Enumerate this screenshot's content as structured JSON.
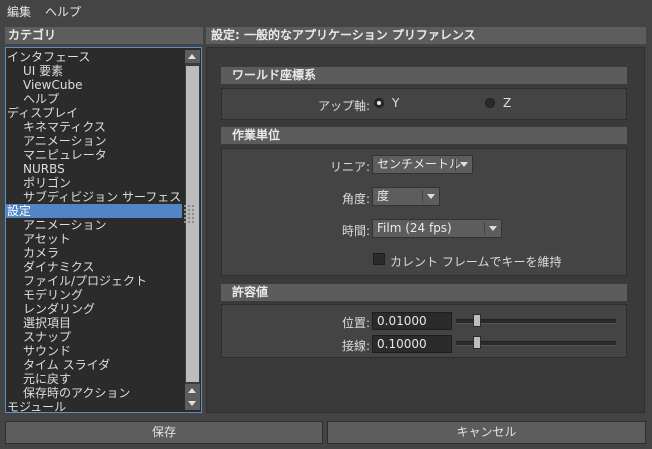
{
  "menu": {
    "edit": "編集",
    "help": "ヘルプ"
  },
  "categories": {
    "header": "カテゴリ",
    "items": [
      {
        "label": "インタフェース",
        "level": "top"
      },
      {
        "label": "UI 要素",
        "level": "sub"
      },
      {
        "label": "ViewCube",
        "level": "sub"
      },
      {
        "label": "ヘルプ",
        "level": "sub"
      },
      {
        "label": "ディスプレイ",
        "level": "top"
      },
      {
        "label": "キネマティクス",
        "level": "sub"
      },
      {
        "label": "アニメーション",
        "level": "sub"
      },
      {
        "label": "マニピュレータ",
        "level": "sub"
      },
      {
        "label": "NURBS",
        "level": "sub"
      },
      {
        "label": "ポリゴン",
        "level": "sub"
      },
      {
        "label": "サブディビジョン サーフェス",
        "level": "sub"
      },
      {
        "label": "設定",
        "level": "top",
        "selected": true
      },
      {
        "label": "アニメーション",
        "level": "sub"
      },
      {
        "label": "アセット",
        "level": "sub"
      },
      {
        "label": "カメラ",
        "level": "sub"
      },
      {
        "label": "ダイナミクス",
        "level": "sub"
      },
      {
        "label": "ファイル/プロジェクト",
        "level": "sub"
      },
      {
        "label": "モデリング",
        "level": "sub"
      },
      {
        "label": "レンダリング",
        "level": "sub"
      },
      {
        "label": "選択項目",
        "level": "sub"
      },
      {
        "label": "スナップ",
        "level": "sub"
      },
      {
        "label": "サウンド",
        "level": "sub"
      },
      {
        "label": "タイム スライダ",
        "level": "sub"
      },
      {
        "label": "元に戻す",
        "level": "sub"
      },
      {
        "label": "保存時のアクション",
        "level": "sub"
      },
      {
        "label": "モジュール",
        "level": "top"
      }
    ]
  },
  "preferences": {
    "header": "設定: 一般的なアプリケーション プリファレンス",
    "world": {
      "title": "ワールド座標系",
      "up_axis_label": "アップ軸:",
      "options": [
        "Y",
        "Z"
      ],
      "selected": "Y"
    },
    "working_units": {
      "title": "作業単位",
      "linear_label": "リニア:",
      "linear_value": "センチメートル",
      "angle_label": "角度:",
      "angle_value": "度",
      "time_label": "時間:",
      "time_value": "Film (24 fps)",
      "keep_keys_label": "カレント フレームでキーを維持",
      "keep_keys_checked": false
    },
    "tolerance": {
      "title": "許容値",
      "position_label": "位置:",
      "position_value": "0.01000",
      "position_slider_fraction": 0.02,
      "tangent_label": "接線:",
      "tangent_value": "0.10000",
      "tangent_slider_fraction": 0.02
    }
  },
  "buttons": {
    "save": "保存",
    "cancel": "キャンセル"
  },
  "colors": {
    "selection": "#5285c6",
    "background": "#444444",
    "list_bg": "#2b2b2b"
  }
}
